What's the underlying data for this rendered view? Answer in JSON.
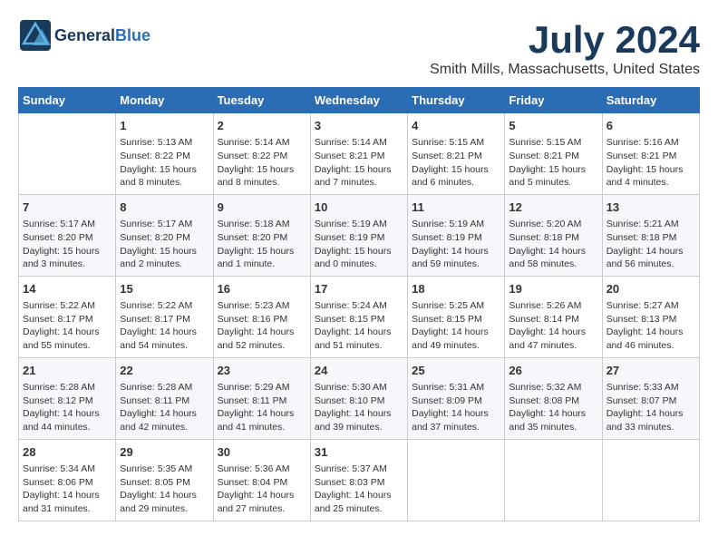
{
  "header": {
    "logo_general": "General",
    "logo_blue": "Blue",
    "month": "July 2024",
    "location": "Smith Mills, Massachusetts, United States"
  },
  "weekdays": [
    "Sunday",
    "Monday",
    "Tuesday",
    "Wednesday",
    "Thursday",
    "Friday",
    "Saturday"
  ],
  "weeks": [
    [
      {
        "day": "",
        "info": ""
      },
      {
        "day": "1",
        "info": "Sunrise: 5:13 AM\nSunset: 8:22 PM\nDaylight: 15 hours\nand 8 minutes."
      },
      {
        "day": "2",
        "info": "Sunrise: 5:14 AM\nSunset: 8:22 PM\nDaylight: 15 hours\nand 8 minutes."
      },
      {
        "day": "3",
        "info": "Sunrise: 5:14 AM\nSunset: 8:21 PM\nDaylight: 15 hours\nand 7 minutes."
      },
      {
        "day": "4",
        "info": "Sunrise: 5:15 AM\nSunset: 8:21 PM\nDaylight: 15 hours\nand 6 minutes."
      },
      {
        "day": "5",
        "info": "Sunrise: 5:15 AM\nSunset: 8:21 PM\nDaylight: 15 hours\nand 5 minutes."
      },
      {
        "day": "6",
        "info": "Sunrise: 5:16 AM\nSunset: 8:21 PM\nDaylight: 15 hours\nand 4 minutes."
      }
    ],
    [
      {
        "day": "7",
        "info": "Sunrise: 5:17 AM\nSunset: 8:20 PM\nDaylight: 15 hours\nand 3 minutes."
      },
      {
        "day": "8",
        "info": "Sunrise: 5:17 AM\nSunset: 8:20 PM\nDaylight: 15 hours\nand 2 minutes."
      },
      {
        "day": "9",
        "info": "Sunrise: 5:18 AM\nSunset: 8:20 PM\nDaylight: 15 hours\nand 1 minute."
      },
      {
        "day": "10",
        "info": "Sunrise: 5:19 AM\nSunset: 8:19 PM\nDaylight: 15 hours\nand 0 minutes."
      },
      {
        "day": "11",
        "info": "Sunrise: 5:19 AM\nSunset: 8:19 PM\nDaylight: 14 hours\nand 59 minutes."
      },
      {
        "day": "12",
        "info": "Sunrise: 5:20 AM\nSunset: 8:18 PM\nDaylight: 14 hours\nand 58 minutes."
      },
      {
        "day": "13",
        "info": "Sunrise: 5:21 AM\nSunset: 8:18 PM\nDaylight: 14 hours\nand 56 minutes."
      }
    ],
    [
      {
        "day": "14",
        "info": "Sunrise: 5:22 AM\nSunset: 8:17 PM\nDaylight: 14 hours\nand 55 minutes."
      },
      {
        "day": "15",
        "info": "Sunrise: 5:22 AM\nSunset: 8:17 PM\nDaylight: 14 hours\nand 54 minutes."
      },
      {
        "day": "16",
        "info": "Sunrise: 5:23 AM\nSunset: 8:16 PM\nDaylight: 14 hours\nand 52 minutes."
      },
      {
        "day": "17",
        "info": "Sunrise: 5:24 AM\nSunset: 8:15 PM\nDaylight: 14 hours\nand 51 minutes."
      },
      {
        "day": "18",
        "info": "Sunrise: 5:25 AM\nSunset: 8:15 PM\nDaylight: 14 hours\nand 49 minutes."
      },
      {
        "day": "19",
        "info": "Sunrise: 5:26 AM\nSunset: 8:14 PM\nDaylight: 14 hours\nand 47 minutes."
      },
      {
        "day": "20",
        "info": "Sunrise: 5:27 AM\nSunset: 8:13 PM\nDaylight: 14 hours\nand 46 minutes."
      }
    ],
    [
      {
        "day": "21",
        "info": "Sunrise: 5:28 AM\nSunset: 8:12 PM\nDaylight: 14 hours\nand 44 minutes."
      },
      {
        "day": "22",
        "info": "Sunrise: 5:28 AM\nSunset: 8:11 PM\nDaylight: 14 hours\nand 42 minutes."
      },
      {
        "day": "23",
        "info": "Sunrise: 5:29 AM\nSunset: 8:11 PM\nDaylight: 14 hours\nand 41 minutes."
      },
      {
        "day": "24",
        "info": "Sunrise: 5:30 AM\nSunset: 8:10 PM\nDaylight: 14 hours\nand 39 minutes."
      },
      {
        "day": "25",
        "info": "Sunrise: 5:31 AM\nSunset: 8:09 PM\nDaylight: 14 hours\nand 37 minutes."
      },
      {
        "day": "26",
        "info": "Sunrise: 5:32 AM\nSunset: 8:08 PM\nDaylight: 14 hours\nand 35 minutes."
      },
      {
        "day": "27",
        "info": "Sunrise: 5:33 AM\nSunset: 8:07 PM\nDaylight: 14 hours\nand 33 minutes."
      }
    ],
    [
      {
        "day": "28",
        "info": "Sunrise: 5:34 AM\nSunset: 8:06 PM\nDaylight: 14 hours\nand 31 minutes."
      },
      {
        "day": "29",
        "info": "Sunrise: 5:35 AM\nSunset: 8:05 PM\nDaylight: 14 hours\nand 29 minutes."
      },
      {
        "day": "30",
        "info": "Sunrise: 5:36 AM\nSunset: 8:04 PM\nDaylight: 14 hours\nand 27 minutes."
      },
      {
        "day": "31",
        "info": "Sunrise: 5:37 AM\nSunset: 8:03 PM\nDaylight: 14 hours\nand 25 minutes."
      },
      {
        "day": "",
        "info": ""
      },
      {
        "day": "",
        "info": ""
      },
      {
        "day": "",
        "info": ""
      }
    ]
  ]
}
